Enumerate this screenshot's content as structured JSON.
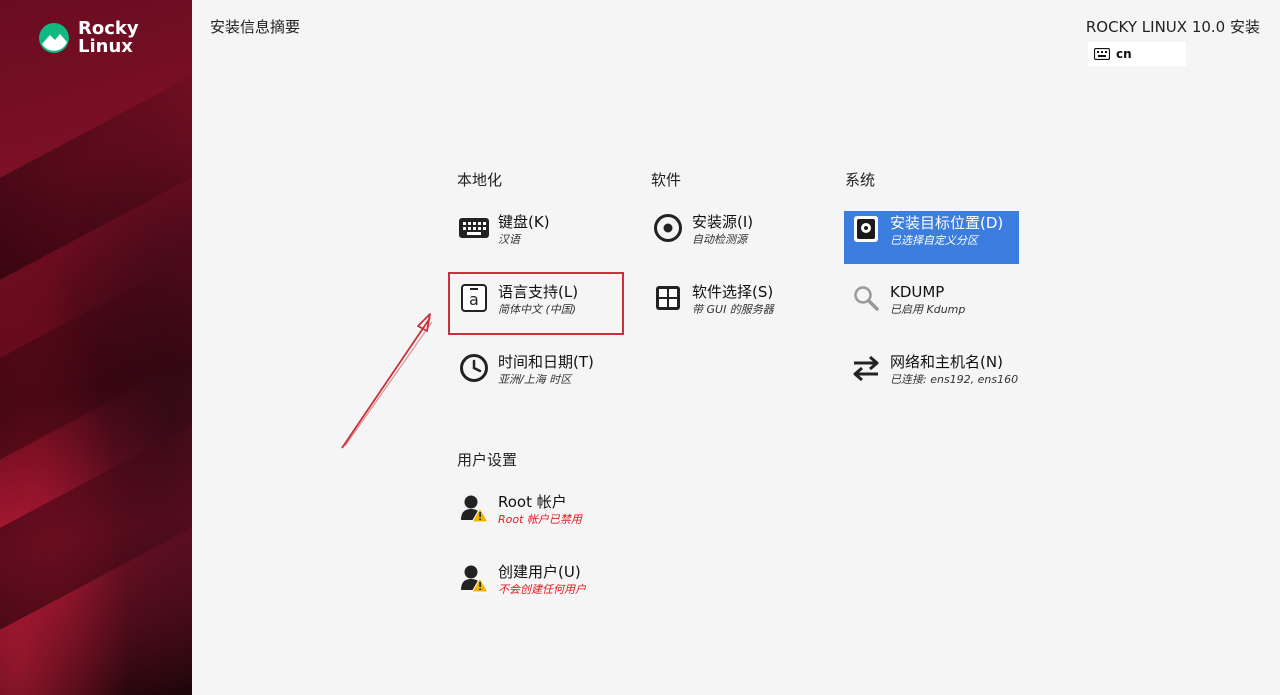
{
  "sidebar": {
    "logo_line1": "Rocky",
    "logo_line2": "Linux"
  },
  "header": {
    "page_title": "安装信息摘要",
    "product_title": "ROCKY LINUX 10.0 安装",
    "keyboard_layout": "cn"
  },
  "sections": {
    "localization": {
      "title": "本地化",
      "keyboard": {
        "label": "键盘(K)",
        "status": "汉语"
      },
      "language": {
        "label": "语言支持(L)",
        "status": "简体中文 (中国)"
      },
      "datetime": {
        "label": "时间和日期(T)",
        "status": "亚洲/上海 时区"
      }
    },
    "software": {
      "title": "软件",
      "source": {
        "label": "安装源(I)",
        "status": "自动检测源"
      },
      "selection": {
        "label": "软件选择(S)",
        "status": "带 GUI 的服务器"
      }
    },
    "system": {
      "title": "系统",
      "destination": {
        "label": "安装目标位置(D)",
        "status": "已选择自定义分区"
      },
      "kdump": {
        "label": "KDUMP",
        "status": "已启用 Kdump"
      },
      "network": {
        "label": "网络和主机名(N)",
        "status": "已连接: ens192, ens160"
      }
    },
    "user": {
      "title": "用户设置",
      "root": {
        "label": "Root 帐户",
        "status": "Root 帐户已禁用"
      },
      "create_user": {
        "label": "创建用户(U)",
        "status": "不会创建任何用户"
      }
    }
  },
  "colors": {
    "accent": "#3c7de0",
    "warning": "#e01b24",
    "annotation": "#c8303a",
    "sidebar": "#7d1026"
  }
}
